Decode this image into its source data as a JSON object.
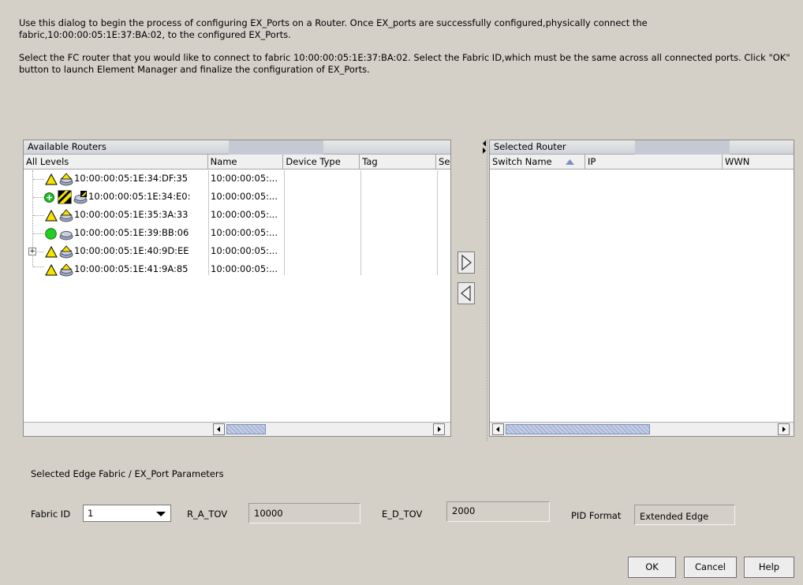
{
  "intro": {
    "paragraph1": "Use this dialog to begin the process of configuring EX_Ports on a Router. Once EX_ports are successfully configured,physically connect the fabric,10:00:00:05:1E:37:BA:02, to the configured EX_Ports.",
    "paragraph2": "Select the FC router that you would like to connect to fabric 10:00:00:05:1E:37:BA:02. Select the Fabric ID,which must be the same across all connected ports. Click \"OK\" button to launch Element Manager and finalize the configuration of EX_Ports."
  },
  "available": {
    "title": "Available Routers",
    "columns": [
      "All Levels",
      "Name",
      "Device Type",
      "Tag",
      "Se"
    ],
    "rows": [
      {
        "wwn": "10:00:00:05:1E:34:DF:35",
        "name": "10:00:00:05:...",
        "status": "warning"
      },
      {
        "wwn": "10:00:00:05:1E:34:E0:",
        "name": "10:00:00:05:...",
        "status": "ok-plus"
      },
      {
        "wwn": "10:00:00:05:1E:35:3A:33",
        "name": "10:00:00:05:...",
        "status": "warning"
      },
      {
        "wwn": "10:00:00:05:1E:39:BB:06",
        "name": "10:00:00:05:...",
        "status": "ok"
      },
      {
        "wwn": "10:00:00:05:1E:40:9D:EE",
        "name": "10:00:00:05:...",
        "status": "warning",
        "expand": "+"
      },
      {
        "wwn": "10:00:00:05:1E:41:9A:85",
        "name": "10:00:00:05:...",
        "status": "warning"
      }
    ]
  },
  "selected": {
    "title": "Selected Router",
    "columns": [
      "Switch Name",
      "IP",
      "WWN"
    ]
  },
  "params": {
    "title": "Selected Edge Fabric / EX_Port Parameters",
    "fabric_id_label": "Fabric ID",
    "fabric_id_value": "1",
    "ratov_label": "R_A_TOV",
    "ratov_value": "10000",
    "edtov_label": "E_D_TOV",
    "edtov_value": "2000",
    "pid_label": "PID Format",
    "pid_value": "Extended Edge"
  },
  "buttons": {
    "ok": "OK",
    "cancel": "Cancel",
    "help": "Help"
  },
  "colors": {
    "warning": "#f5e400",
    "ok": "#22bb22",
    "thumb": "#aab6d6"
  }
}
